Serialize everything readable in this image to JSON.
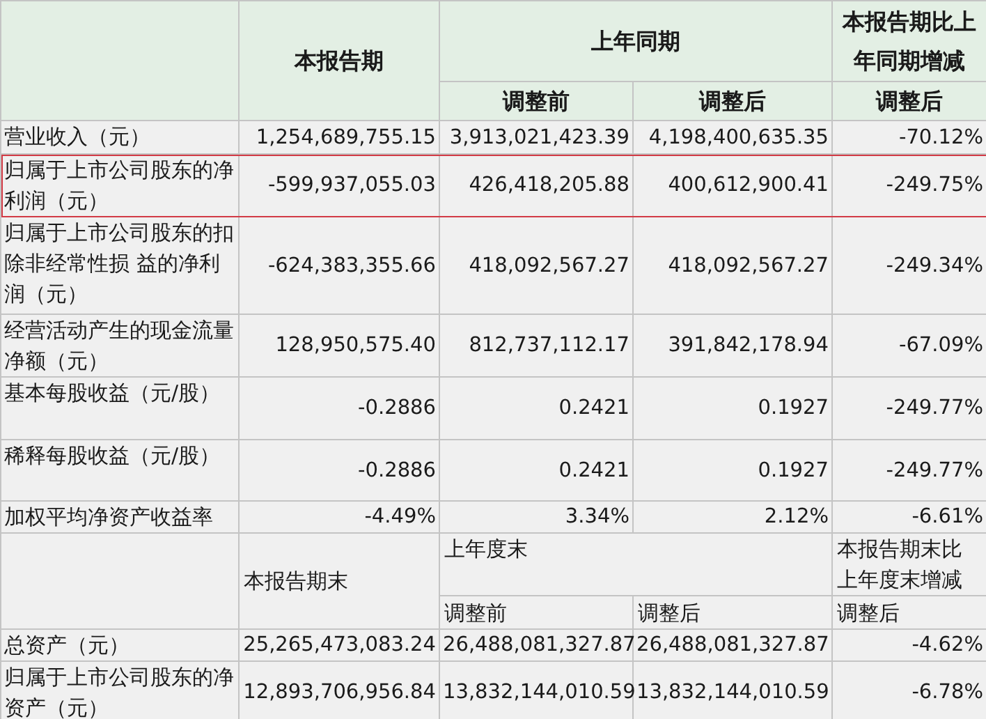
{
  "header": {
    "current": "本报告期",
    "prior": "上年同期",
    "change": "本报告期比上年同期增减",
    "sub": [
      "调整前",
      "调整后",
      "调整后"
    ]
  },
  "rows": [
    {
      "label": "营业收入（元）",
      "values": [
        "1,254,689,755.15",
        "3,913,021,423.39",
        "4,198,400,635.35",
        "-70.12%"
      ],
      "highlighted": false
    },
    {
      "label": "归属于上市公司股东的净利润（元）",
      "values": [
        "-599,937,055.03",
        "426,418,205.88",
        "400,612,900.41",
        "-249.75%"
      ],
      "highlighted": true
    },
    {
      "label": "归属于上市公司股东的扣除非经常性损 益的净利润（元）",
      "values": [
        "-624,383,355.66",
        "418,092,567.27",
        "418,092,567.27",
        "-249.34%"
      ],
      "highlighted": false
    },
    {
      "label": "经营活动产生的现金流量净额（元）",
      "values": [
        "128,950,575.40",
        "812,737,112.17",
        "391,842,178.94",
        "-67.09%"
      ],
      "highlighted": false
    },
    {
      "label": "基本每股收益（元/股）",
      "values": [
        "-0.2886",
        "0.2421",
        "0.1927",
        "-249.77%"
      ],
      "highlighted": false
    },
    {
      "label": "稀释每股收益（元/股）",
      "values": [
        "-0.2886",
        "0.2421",
        "0.1927",
        "-249.77%"
      ],
      "highlighted": false
    },
    {
      "label": "加权平均净资产收益率",
      "values": [
        "-4.49%",
        "3.34%",
        "2.12%",
        "-6.61%"
      ],
      "highlighted": false
    }
  ],
  "header2": {
    "current": "本报告期末",
    "prior": "上年度末",
    "change": "本报告期末比上年度末增减",
    "sub": [
      "调整前",
      "调整后",
      "调整后"
    ]
  },
  "rows2": [
    {
      "label": "总资产（元）",
      "values": [
        "25,265,473,083.24",
        "26,488,081,327.87",
        "26,488,081,327.87",
        "-4.62%"
      ],
      "highlighted": false
    },
    {
      "label": "归属于上市公司股东的净资产（元）",
      "values": [
        "12,893,706,956.84",
        "13,832,144,010.59",
        "13,832,144,010.59",
        "-6.78%"
      ],
      "highlighted": false
    }
  ]
}
